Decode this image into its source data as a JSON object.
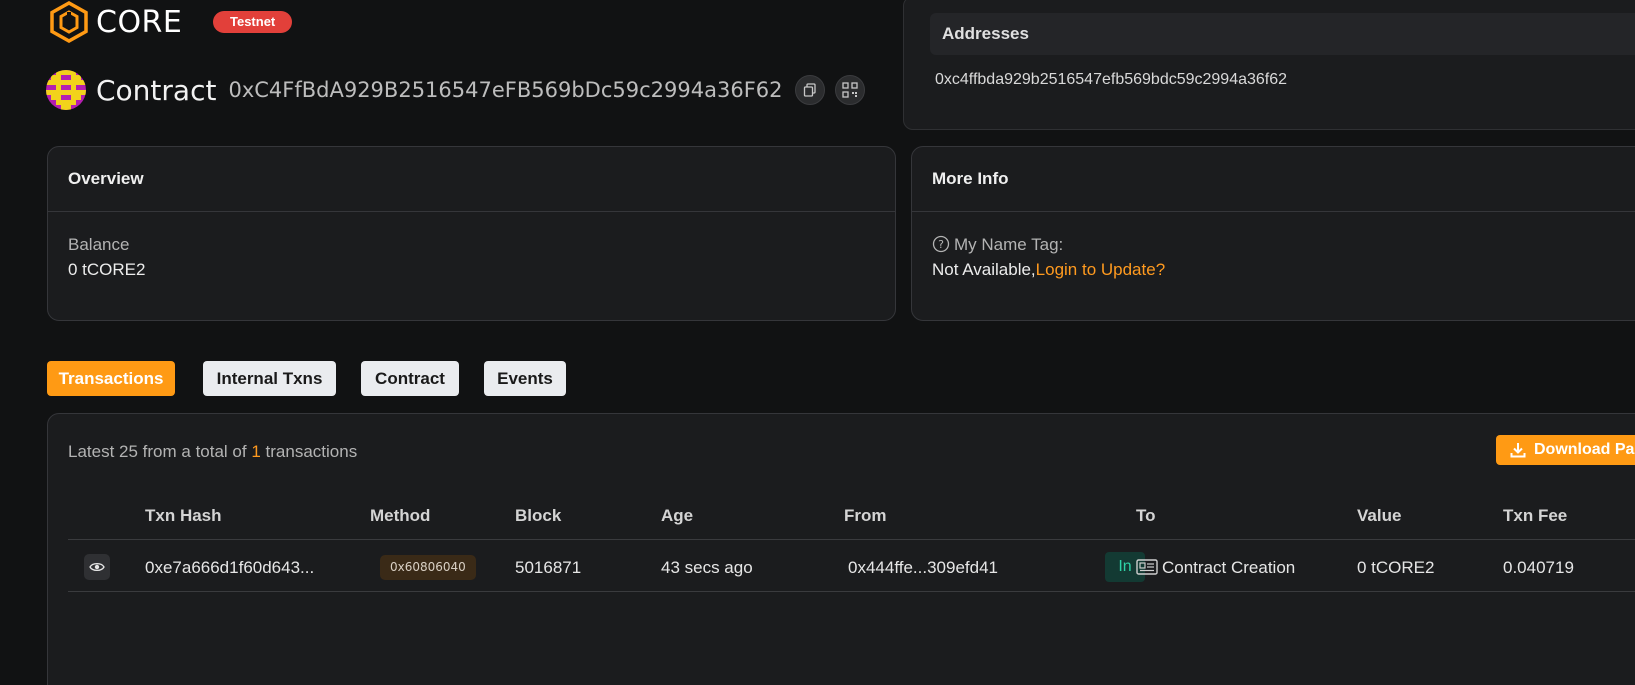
{
  "header": {
    "logo_text": "CORE",
    "network_badge": "Testnet"
  },
  "contract": {
    "label": "Contract",
    "address": "0xC4FfBdA929B2516547eFB569bDc59c2994a36F62",
    "copy_icon": "copy-icon",
    "qr_icon": "qr-code-icon"
  },
  "addresses": {
    "title": "Addresses",
    "value": "0xc4ffbda929b2516547efb569bdc59c2994a36f62"
  },
  "overview": {
    "title": "Overview",
    "balance_label": "Balance",
    "balance_value": "0 tCORE2"
  },
  "more_info": {
    "title": "More Info",
    "name_tag_label": "My Name Tag:",
    "name_tag_value": "Not Available,",
    "login_link": "Login to Update?"
  },
  "tabs": [
    {
      "label": "Transactions",
      "active": true
    },
    {
      "label": "Internal Txns",
      "active": false
    },
    {
      "label": "Contract",
      "active": false
    },
    {
      "label": "Events",
      "active": false
    }
  ],
  "transactions": {
    "summary_prefix": "Latest 25 from a total of",
    "summary_count": "1",
    "summary_suffix": "transactions",
    "download_label": "Download Pag",
    "columns": [
      "Txn Hash",
      "Method",
      "Block",
      "Age",
      "From",
      "To",
      "Value",
      "Txn Fee"
    ],
    "rows": [
      {
        "hash": "0xe7a666d1f60d643...",
        "method": "0x60806040",
        "block": "5016871",
        "age": "43 secs ago",
        "from": "0x444ffe...309efd41",
        "direction": "In",
        "to": "Contract Creation",
        "value": "0 tCORE2",
        "fee": "0.040719"
      }
    ]
  },
  "colors": {
    "accent": "#ff9a14",
    "badge_red": "#e2403a",
    "in_green": "#2ed3a6",
    "background": "#111213",
    "card": "#1b1c1e"
  }
}
